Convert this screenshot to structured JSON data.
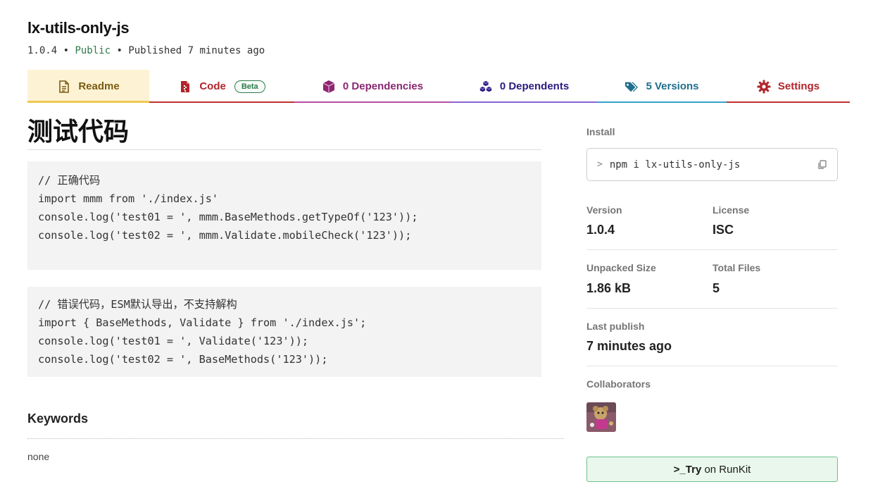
{
  "package": {
    "name": "lx-utils-only-js",
    "version": "1.0.4",
    "sep1": " • ",
    "visibility": "Public",
    "sep2": " • ",
    "published": "Published 7 minutes ago"
  },
  "tabs": [
    {
      "label": "Readme",
      "icon": "readme-file-icon"
    },
    {
      "label": "Code",
      "icon": "code-file-icon",
      "badge": "Beta"
    },
    {
      "label": "0 Dependencies",
      "icon": "cube-icon"
    },
    {
      "label": "0 Dependents",
      "icon": "cubes-icon"
    },
    {
      "label": "5 Versions",
      "icon": "tags-icon"
    },
    {
      "label": "Settings",
      "icon": "gear-icon"
    }
  ],
  "readme": {
    "heading": "测试代码",
    "code_blocks": [
      {
        "lines": [
          "// 正确代码",
          "import mmm from './index.js'",
          "console.log('test01 = ', mmm.BaseMethods.getTypeOf('123'));",
          "console.log('test02 = ', mmm.Validate.mobileCheck('123'));"
        ]
      },
      {
        "lines": [
          "// 错误代码，ESM默认导出，不支持解构",
          "import { BaseMethods, Validate } from './index.js';",
          "console.log('test01 = ', Validate('123'));",
          "console.log('test02 = ', BaseMethods('123'));"
        ]
      }
    ],
    "keywords_title": "Keywords",
    "keywords_value": "none"
  },
  "sidebar": {
    "install_label": "Install",
    "install_prompt": ">",
    "install_command": "npm i lx-utils-only-js",
    "version_label": "Version",
    "version_value": "1.0.4",
    "license_label": "License",
    "license_value": "ISC",
    "unpacked_size_label": "Unpacked Size",
    "unpacked_size_value": "1.86 kB",
    "total_files_label": "Total Files",
    "total_files_value": "5",
    "last_publish_label": "Last publish",
    "last_publish_value": "7 minutes ago",
    "collaborators_label": "Collaborators",
    "runkit_prefix": ">_",
    "runkit_try": "Try",
    "runkit_suffix": " on RunKit"
  },
  "colors": {
    "public_green": "#2d7a4a",
    "readme_tab_bg": "#fdf3d4",
    "code_tab": "#b0242b",
    "deps_tab": "#8a2870",
    "dependents_tab": "#2c1b80",
    "versions_tab": "#1f6f8b",
    "settings_tab": "#b0242b",
    "runkit_bg": "#e9f7ec"
  }
}
